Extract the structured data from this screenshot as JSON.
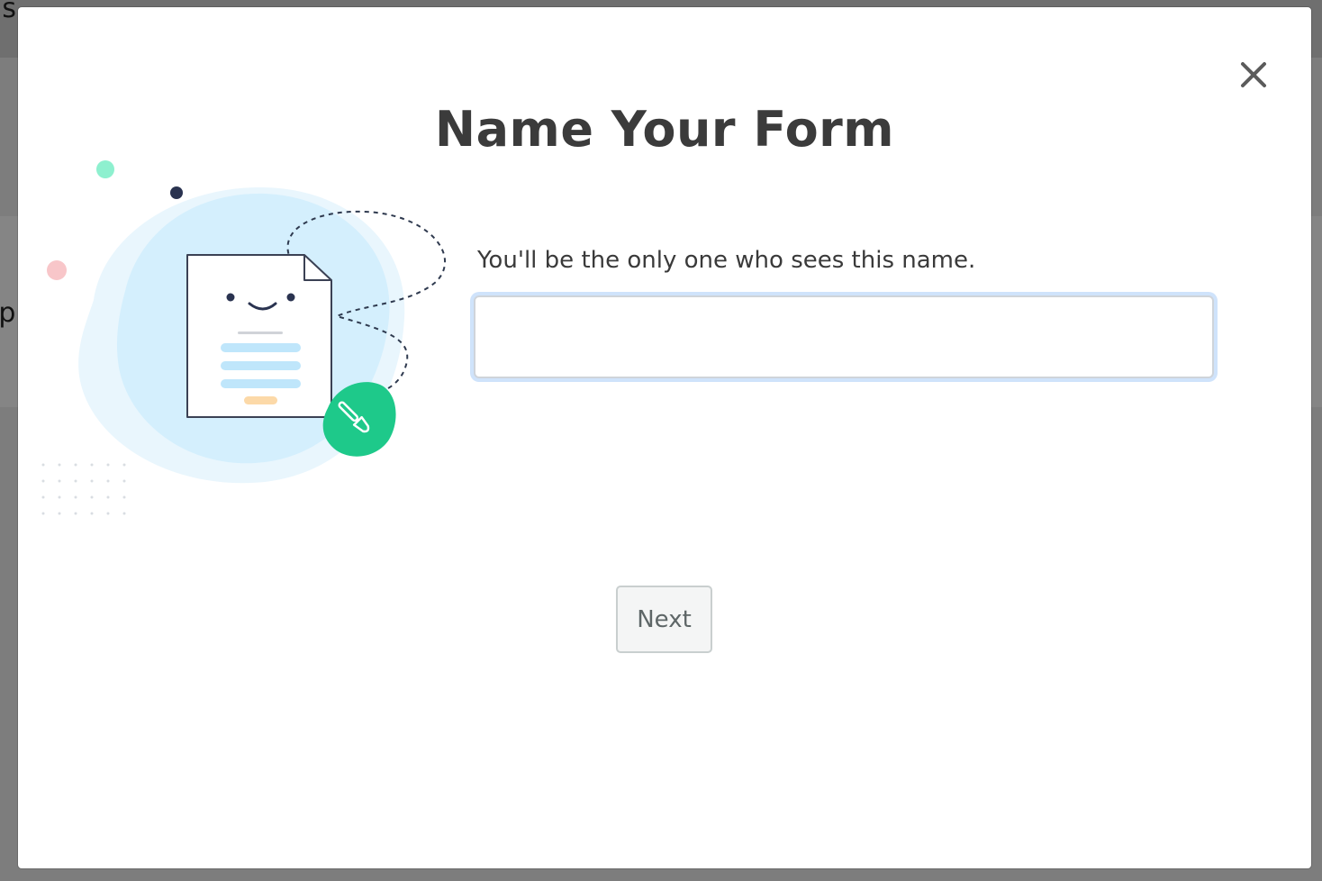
{
  "background": {
    "text_top": "is",
    "text_mid": "ip"
  },
  "modal": {
    "title": "Name Your Form",
    "hint": "You'll be the only one who sees this name.",
    "name_input": {
      "value": "",
      "placeholder": ""
    },
    "next_label": "Next",
    "close_icon": "close-icon",
    "illustration_icon": "paintbrush-icon"
  },
  "colors": {
    "title": "#3b3b3b",
    "accent_green": "#1ec98a",
    "blob": "#d7f0fd",
    "input_focus": "#cfe3fb"
  }
}
